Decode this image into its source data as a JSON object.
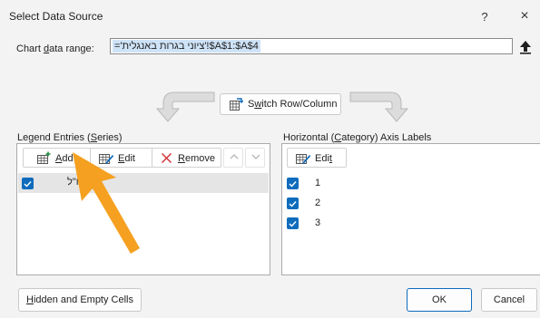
{
  "dialog": {
    "title": "Select Data Source",
    "help_label": "?",
    "close_label": "×"
  },
  "range": {
    "label_pre": "Chart ",
    "label_key": "d",
    "label_post": "ata range:",
    "value": "='ציוני בגרות באנגלית'!$A$1:$A$4"
  },
  "switch": {
    "label_pre": "S",
    "label_key": "w",
    "label_post": "itch Row/Column"
  },
  "legend": {
    "label_pre": "Legend Entries (",
    "label_key": "S",
    "label_post": "eries)",
    "add_key": "A",
    "add_rest": "dd",
    "edit_pre": "",
    "edit_key": "E",
    "edit_rest": "dit",
    "remove_key": "R",
    "remove_rest": "emove",
    "series": [
      {
        "name": "3 יח\"ל",
        "checked": true
      }
    ]
  },
  "axis": {
    "label_pre": "Horizontal (",
    "label_key": "C",
    "label_post": "ategory) Axis Labels",
    "edit_pre": "Edi",
    "edit_key": "t",
    "items": [
      {
        "label": "1",
        "checked": true
      },
      {
        "label": "2",
        "checked": true
      },
      {
        "label": "3",
        "checked": true
      }
    ]
  },
  "footer": {
    "hidden_key": "H",
    "hidden_rest": "idden and Empty Cells",
    "ok_label": "OK",
    "cancel_label": "Cancel"
  },
  "colors": {
    "accent": "#0f6cbd",
    "pointer": "#f5a020",
    "selection": "#cfe3f7"
  }
}
